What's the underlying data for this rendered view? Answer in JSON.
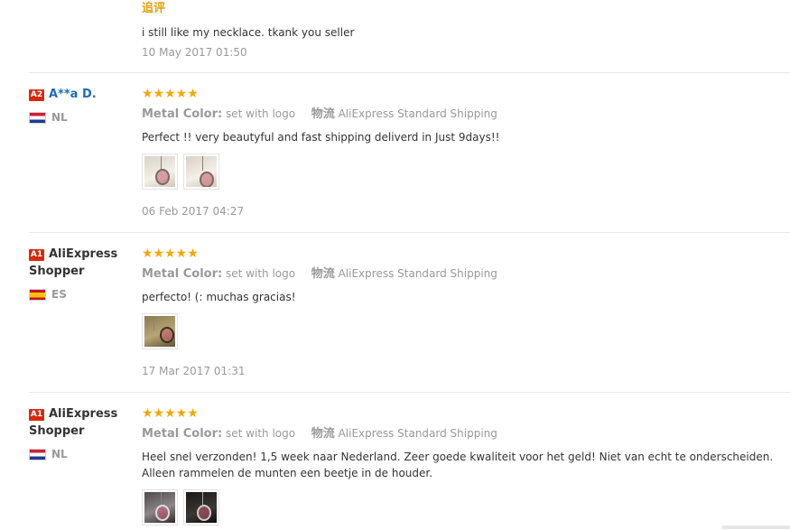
{
  "top_followup": {
    "label": "追评",
    "text": "i still like my necklace. tkank you seller",
    "date": "10 May 2017 01:50"
  },
  "attr_labels": {
    "metal_color": "Metal Color:",
    "logistics": "物流"
  },
  "reviews": [
    {
      "level": "A2",
      "name": "A**a D.",
      "country": "NL",
      "flag": "netherlands-flag-icon",
      "stars": "★★★★★",
      "rating": 5,
      "metal_color": "set with logo",
      "shipping": "AliExpress Standard Shipping",
      "feedback": "Perfect !! very beautyful and fast shipping deliverd in Just 9days!!",
      "photos": 2,
      "date": "06 Feb 2017 04:27"
    },
    {
      "level": "A1",
      "name": "AliExpress Shopper",
      "country": "ES",
      "flag": "spain-flag-icon",
      "stars": "★★★★★",
      "rating": 5,
      "metal_color": "set with logo",
      "shipping": "AliExpress Standard Shipping",
      "feedback": "perfecto! (: muchas gracias!",
      "photos": 1,
      "date": "17 Mar 2017 01:31"
    },
    {
      "level": "A1",
      "name": "AliExpress Shopper",
      "country": "NL",
      "flag": "netherlands-flag-icon",
      "stars": "★★★★★",
      "rating": 5,
      "metal_color": "set with logo",
      "shipping": "AliExpress Standard Shipping",
      "feedback": "Heel snel verzonden! 1,5 week naar Nederland. Zeer goede kwaliteit voor het geld! Niet van echt te onderscheiden. Alleen rammelen de munten een beetje in de houder.",
      "photos": 2,
      "date": ""
    }
  ],
  "colors": {
    "star": "#f6a700",
    "badge": "#d9290d",
    "link": "#1e6bb8",
    "followup": "#e5a00d"
  }
}
